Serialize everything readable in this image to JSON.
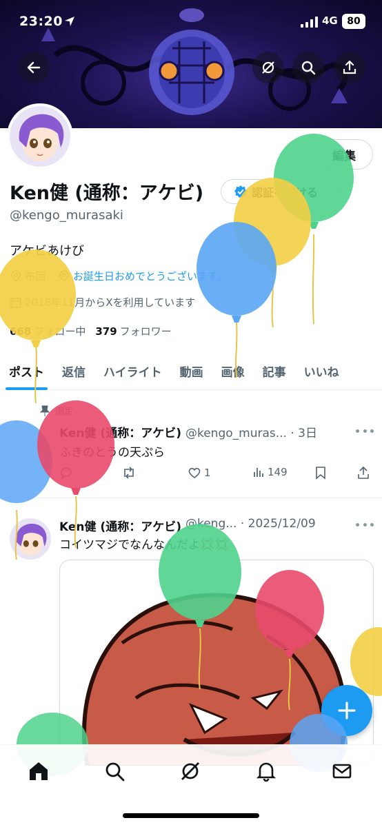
{
  "status_bar": {
    "time": "23:20",
    "network": "4G",
    "battery": "80"
  },
  "header": {
    "back_icon": "arrow-left-icon",
    "grok_icon": "grok-icon",
    "search_icon": "search-icon",
    "share_icon": "share-icon"
  },
  "profile": {
    "edit_label": "編集",
    "display_name": "Ken健 (通称：アケビ)",
    "verify_label": "認証を受ける",
    "handle": "@kengo_murasaki",
    "bio": "アケビあけび",
    "location": "布団",
    "birthday_link": "お誕生日おめでとうございます。",
    "joined": "2018年11月からXを利用しています",
    "following_count": "668",
    "following_label": "フォロー中",
    "followers_count": "379",
    "followers_label": "フォロワー"
  },
  "tabs": [
    "ポスト",
    "返信",
    "ハイライト",
    "動画",
    "画像",
    "記事",
    "いいね"
  ],
  "posts": [
    {
      "pinned_label": "固定",
      "name": "Ken健 (通称：アケビ)",
      "handle_time": "@kengo_muras... · 3日",
      "text": "ふきのとうの天ぷら",
      "replies": "",
      "reposts": "",
      "likes": "1",
      "views": "149"
    },
    {
      "name": "Ken健 (通称：アケビ)",
      "handle_time": "@keng... · 2025/12/09",
      "text": "コイツマジでなんなんだよ💢💢"
    }
  ],
  "bottom_nav": [
    "home-icon",
    "search-icon",
    "grok-icon",
    "bell-icon",
    "mail-icon"
  ],
  "colors": {
    "accent": "#1d9bf0",
    "text": "#0f1419",
    "muted": "#536471"
  }
}
